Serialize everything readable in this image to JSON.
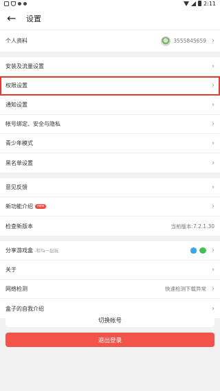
{
  "status_bar": {
    "time": "2:11"
  },
  "header": {
    "title": "设置"
  },
  "profile": {
    "label": "个人资料",
    "user_id": "3555845659"
  },
  "group2": [
    {
      "label": "安装及流量设置"
    },
    {
      "label": "权限设置"
    },
    {
      "label": "通知设置"
    },
    {
      "label": "帐号绑定、安全与隐私"
    },
    {
      "label": "青少年模式"
    },
    {
      "label": "黑名单设置"
    }
  ],
  "group3": {
    "feedback": "意见反馈",
    "new_features": "新功能介绍",
    "new_badge": "new",
    "check_version": "检查新版本",
    "current_version": "当前版本:7.2.1.30"
  },
  "group4": {
    "share": "分享游戏盒",
    "share_sub": "-和Ta一起玩",
    "about": "关于",
    "network": "网络检测",
    "network_hint": "快速检测下载异常",
    "intro": "盒子的自我介绍"
  },
  "buttons": {
    "switch_account": "切换帐号",
    "logout": "退出登录"
  },
  "colors": {
    "highlight": "#e53935",
    "logout": "#f3544a"
  }
}
